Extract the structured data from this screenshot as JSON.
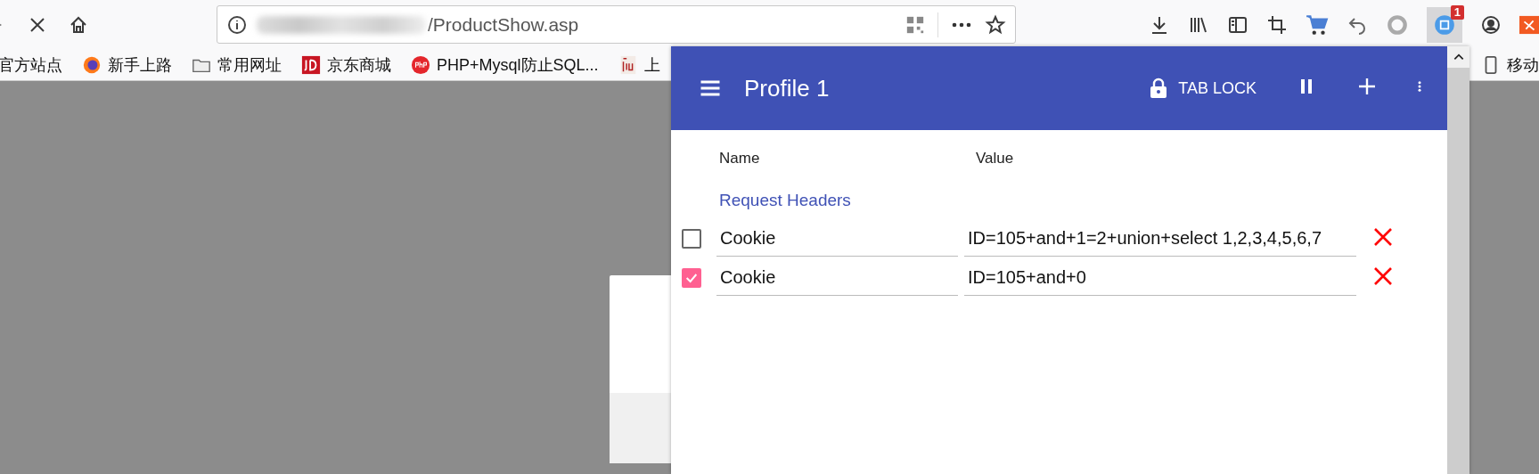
{
  "toolbar": {
    "url": "/ProductShow.asp",
    "extension_badge": "1"
  },
  "bookmarks": [
    {
      "kind": "none",
      "label": "官方站点"
    },
    {
      "kind": "firefox",
      "label": "新手上路"
    },
    {
      "kind": "folder",
      "label": "常用网址"
    },
    {
      "kind": "jd",
      "label": "京东商城"
    },
    {
      "kind": "php",
      "label": "PHP+Mysql防止SQL..."
    },
    {
      "kind": "ijucn",
      "label": "上"
    },
    {
      "kind": "phone",
      "label": "移动"
    }
  ],
  "popup": {
    "title": "Profile 1",
    "tab_lock": "TAB LOCK",
    "columns": [
      "Name",
      "Value"
    ],
    "section": "Request Headers",
    "headers": [
      {
        "checked": false,
        "name": "Cookie",
        "value": "ID=105+and+1=2+union+select 1,2,3,4,5,6,7"
      },
      {
        "checked": true,
        "name": "Cookie",
        "value": "ID=105+and+0"
      }
    ]
  }
}
